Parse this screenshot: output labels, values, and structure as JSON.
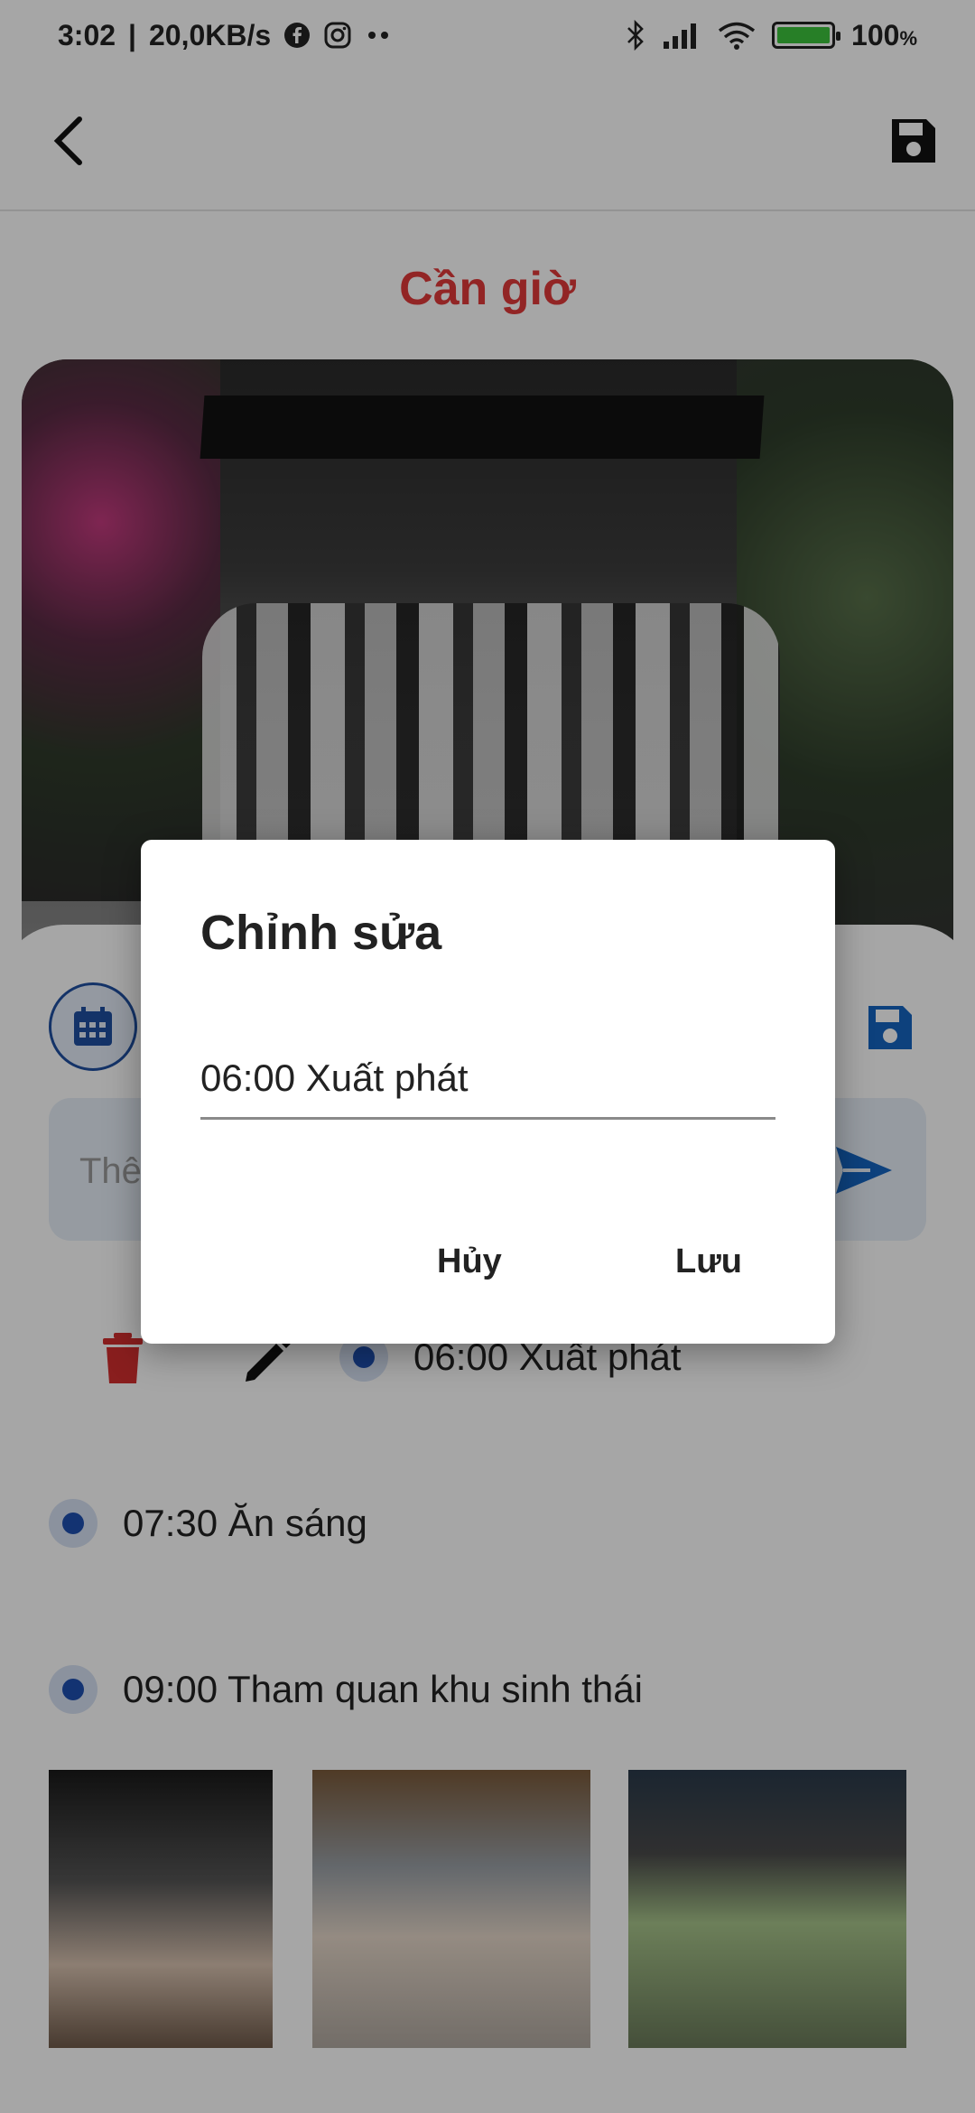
{
  "status_bar": {
    "time": "3:02",
    "network_speed": "20,0KB/s",
    "battery_percent": "100",
    "battery_unit": "%",
    "battery_level": 1.0,
    "icons": [
      "facebook-icon",
      "instagram-icon",
      "more-dots-icon",
      "bluetooth-icon",
      "signal-icon",
      "wifi-icon",
      "battery-icon"
    ]
  },
  "app_bar": {
    "back_icon": "back-arrow-icon",
    "save_icon": "floppy-disk-icon"
  },
  "trip": {
    "title": "Cần giờ"
  },
  "sheet": {
    "calendar_icon": "calendar-icon",
    "save_icon": "floppy-disk-icon",
    "input_placeholder": "Thê",
    "send_icon": "send-icon",
    "schedule": [
      {
        "text": "06:00 Xuất phát"
      },
      {
        "text": "07:30 Ăn sáng"
      },
      {
        "text": "09:00 Tham quan khu sinh thái"
      }
    ],
    "delete_icon": "trash-icon",
    "edit_icon": "pencil-icon"
  },
  "dialog": {
    "title": "Chỉnh sửa",
    "input_value": "06:00 Xuất phát",
    "cancel_label": "Hủy",
    "save_label": "Lưu"
  },
  "colors": {
    "title_red": "#e03a3a",
    "accent_blue": "#1e4fb0",
    "delete_red": "#d32f2f",
    "input_bg": "#e6eef8"
  }
}
